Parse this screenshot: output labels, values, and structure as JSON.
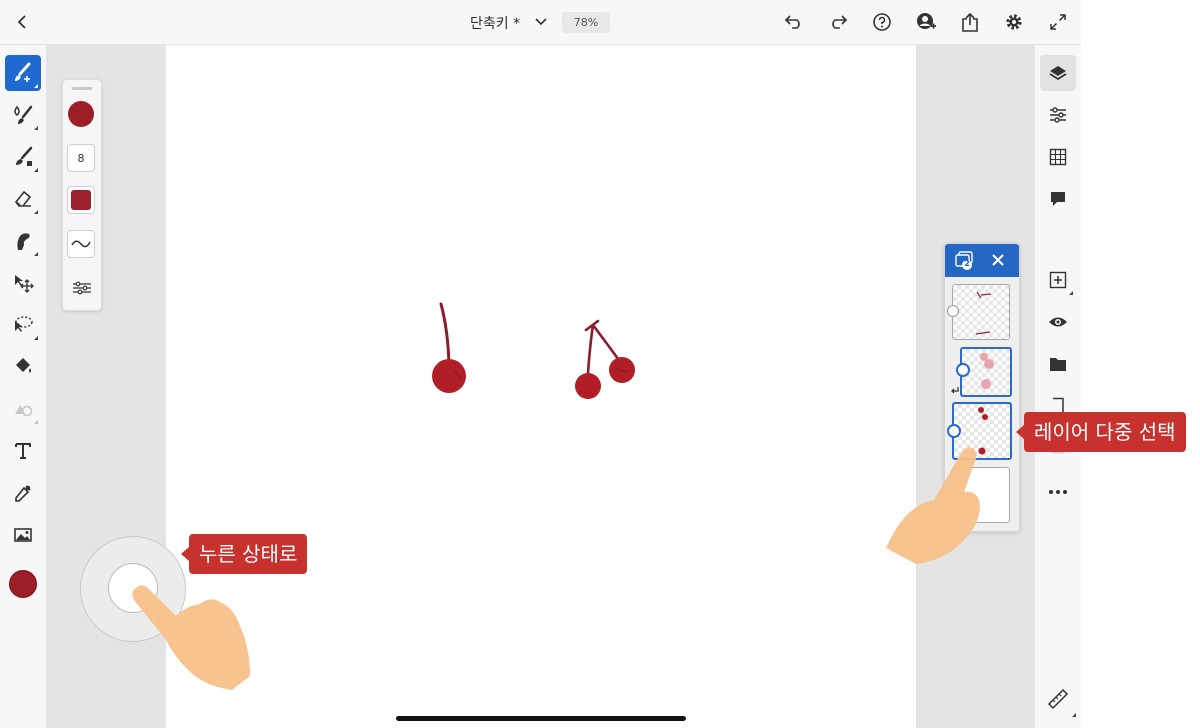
{
  "header": {
    "document_title": "단축키 *",
    "zoom": "78%",
    "icons": [
      "back-icon",
      "title-dropdown-icon",
      "undo-icon",
      "redo-icon",
      "help-icon",
      "invite-user-icon",
      "share-icon",
      "settings-icon",
      "fullscreen-icon"
    ]
  },
  "left_toolbar": {
    "tools": [
      "brush-tool",
      "watercolor-tool",
      "pixel-brush-tool",
      "eraser-tool",
      "smudge-tool",
      "transform-tool",
      "lasso-select-tool",
      "fill-tool",
      "shape-tool",
      "text-tool",
      "eyedropper-tool",
      "image-tool",
      "color-swatch"
    ],
    "active_tool": "brush-tool"
  },
  "brush_panel": {
    "size": "8",
    "color": "#9c1e26"
  },
  "right_toolbar": {
    "tools": [
      "layers-icon",
      "adjustments-icon",
      "grid-icon",
      "comments-icon",
      "add-layer-icon",
      "visibility-icon",
      "folder-icon",
      "merge-icon",
      "blend-icon",
      "more-icon",
      "ruler-icon"
    ],
    "active_tool": "layers-icon"
  },
  "layers_panel": {
    "selected_count": "2",
    "layers": [
      {
        "content": "stems-layer",
        "selected": false
      },
      {
        "content": "cherry-blur-layer",
        "selected": true
      },
      {
        "content": "cherries-layer",
        "selected": true
      },
      {
        "content": "background-layer",
        "selected": false
      }
    ]
  },
  "callouts": {
    "press_hold": "누른 상태로",
    "multi_select": "레이어 다중 선택"
  },
  "colors": {
    "accent": "#1e6ad0",
    "panel_header": "#2467c4",
    "cherry": "#b01e28",
    "callout": "#c8322e",
    "finger": "#f7c189"
  }
}
